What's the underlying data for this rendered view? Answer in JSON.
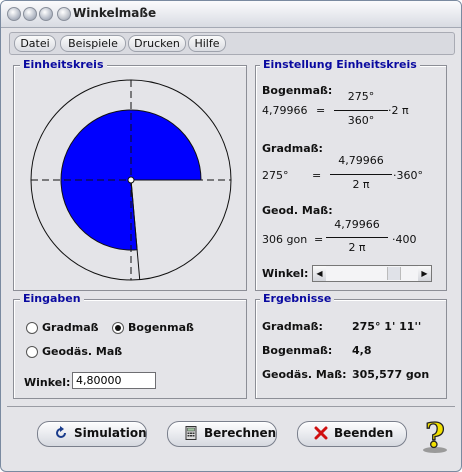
{
  "window": {
    "title": "Winkelmaße"
  },
  "menu": {
    "items": [
      "Datei",
      "Beispiele",
      "Drucken",
      "Hilfe"
    ]
  },
  "einheitskreis": {
    "legend": "Einheitskreis",
    "angle_degrees": 275,
    "fill_color": "#0000ff"
  },
  "einstellung": {
    "legend": "Einstellung Einheitskreis",
    "bogenmass_label": "Bogenmaß:",
    "bogenmass_value": "4,79966",
    "bogenmass_eq": "=",
    "bogenmass_num": "275°",
    "bogenmass_den": "360°",
    "bogenmass_factor": "·2 π",
    "gradmass_label": "Gradmaß:",
    "gradmass_value": "275°",
    "gradmass_eq": "=",
    "gradmass_num": "4,79966",
    "gradmass_den": "2 π",
    "gradmass_factor": "·360°",
    "geod_label": "Geod. Maß:",
    "geod_value": "306 gon",
    "geod_eq": "=",
    "geod_num": "4,79966",
    "geod_den": "2 π",
    "geod_factor": "·400",
    "winkel_label": "Winkel:",
    "slider_position": 0.76
  },
  "eingaben": {
    "legend": "Eingaben",
    "option_gradmass": "Gradmaß",
    "option_bogenmass": "Bogenmaß",
    "option_geodaes": "Geodäs. Maß",
    "selected": "Bogenmaß",
    "winkel_label": "Winkel:",
    "winkel_value": "4,80000"
  },
  "ergebnisse": {
    "legend": "Ergebnisse",
    "gradmass_label": "Gradmaß:",
    "gradmass_value": "275° 1' 11''",
    "bogenmass_label": "Bogenmaß:",
    "bogenmass_value": "4,8",
    "geodaes_label": "Geodäs. Maß:",
    "geodaes_value": "305,577 gon"
  },
  "buttons": {
    "simulation": "Simulation",
    "berechnen": "Berechnen",
    "beenden": "Beenden"
  },
  "icons": {
    "simulation": "refresh-icon",
    "berechnen": "calculator-icon",
    "beenden": "close-x-icon",
    "help": "help-question-icon"
  }
}
